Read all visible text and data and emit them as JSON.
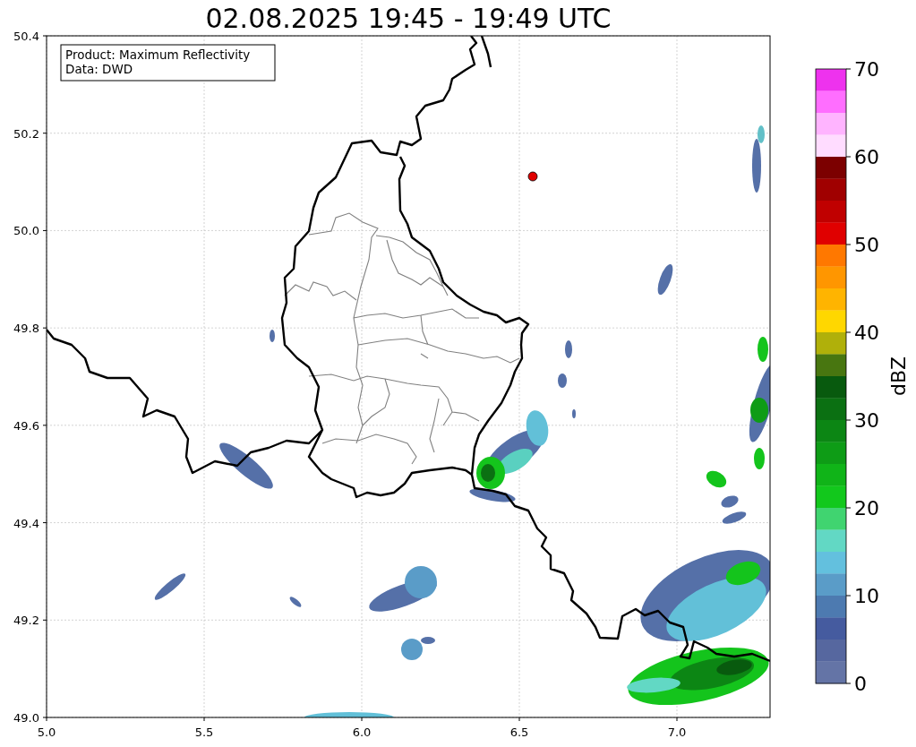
{
  "title": "02.08.2025 19:45 - 19:49 UTC",
  "info_box": {
    "lines": [
      "Product: Maximum Reflectivity",
      "Data: DWD"
    ]
  },
  "axes": {
    "x_ticks": [
      "5.0",
      "5.5",
      "6.0",
      "6.5",
      "7.0"
    ],
    "y_ticks": [
      "50.4",
      "50.2",
      "50.0",
      "49.8",
      "49.6",
      "49.4",
      "49.2",
      "49.0"
    ]
  },
  "colorbar": {
    "label": "dBZ",
    "ticks": [
      "70",
      "60",
      "50",
      "40",
      "30",
      "20",
      "10",
      "0"
    ],
    "segments": [
      {
        "color": "#ee32ee"
      },
      {
        "color": "#ff6eff"
      },
      {
        "color": "#ffb4ff"
      },
      {
        "color": "#ffdcff"
      },
      {
        "color": "#7c0000"
      },
      {
        "color": "#a00000"
      },
      {
        "color": "#c00000"
      },
      {
        "color": "#e00000"
      },
      {
        "color": "#ff7800"
      },
      {
        "color": "#ff9600"
      },
      {
        "color": "#ffb400"
      },
      {
        "color": "#ffd700"
      },
      {
        "color": "#b0b00a"
      },
      {
        "color": "#487610"
      },
      {
        "color": "#085a0e"
      },
      {
        "color": "#0b7012"
      },
      {
        "color": "#0c8614"
      },
      {
        "color": "#0e9c16"
      },
      {
        "color": "#10b418"
      },
      {
        "color": "#12c81c"
      },
      {
        "color": "#40d470"
      },
      {
        "color": "#62d8c4"
      },
      {
        "color": "#63c0de"
      },
      {
        "color": "#5a9cc8"
      },
      {
        "color": "#4d7ab0"
      },
      {
        "color": "#455b9f"
      },
      {
        "color": "#56679f"
      },
      {
        "color": "#6474a6"
      }
    ]
  }
}
